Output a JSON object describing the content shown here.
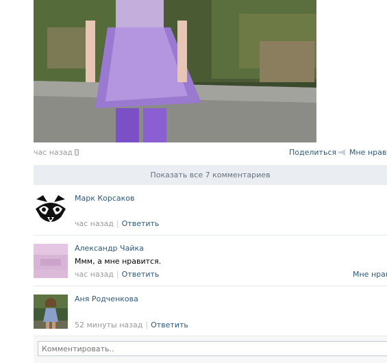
{
  "post": {
    "time": "час назад",
    "share_label": "Поделиться",
    "like_label": "Мне нрави"
  },
  "show_all_label": "Показать все 7 комментариев",
  "comments": [
    {
      "author": "Марк Корсаков",
      "text": "",
      "time": "час назад",
      "reply": "Ответить",
      "like": ""
    },
    {
      "author": "Александр Чайка",
      "text": "Ммм, а мне нравится.",
      "time": "час назад",
      "reply": "Ответить",
      "like": "Мне нрави"
    },
    {
      "author": "Аня Родченкова",
      "text": "",
      "time": "52 минуты назад",
      "reply": "Ответить",
      "like": ""
    }
  ],
  "comment_box": {
    "placeholder": "Комментировать.."
  },
  "icons": {
    "mobile": "phone-icon",
    "share": "megaphone-icon",
    "avatar_1": "raccoon-avatar",
    "avatar_2": "lilac-fabric-avatar",
    "avatar_3": "girl-photo-avatar"
  },
  "colors": {
    "link": "#2b587a",
    "muted": "#999999",
    "band": "#eaedf1"
  }
}
